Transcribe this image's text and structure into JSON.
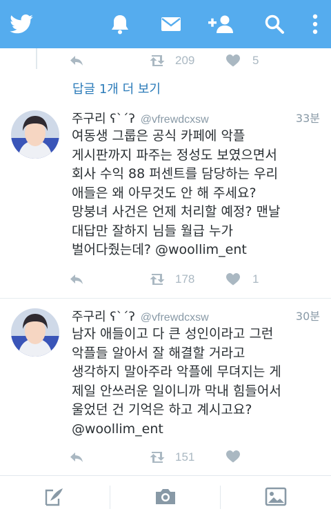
{
  "topbar": {
    "color": "#55acee",
    "icons": [
      "twitter-bird-icon",
      "notifications-bell-icon",
      "messages-envelope-icon",
      "follow-add-user-icon",
      "search-icon",
      "more-vertical-icon"
    ]
  },
  "prev_tweet": {
    "retweets": "209",
    "likes": "5"
  },
  "more_replies_label": "답글 1개 더 보기",
  "tweets": [
    {
      "name": "주구리 ʕ`´ʔ",
      "handle": "@vfrewdcxsw",
      "time": "33분",
      "lines": [
        "여동생 그룹은 공식 카페에 악플",
        "게시판까지 파주는 정성도 보였으면서",
        "회사 수익 88 퍼센트를 담당하는 우리",
        "애들은 왜 아무것도 안 해 주세요?",
        "망붕녀 사건은 언제 처리할 예정? 맨날",
        "대답만 잘하지 님들 월급 누가",
        "벌어다줬는데? @woollim_ent"
      ],
      "retweets": "178",
      "likes": "1"
    },
    {
      "name": "주구리 ʕ`´ʔ",
      "handle": "@vfrewdcxsw",
      "time": "30분",
      "lines": [
        "남자 애들이고 다 큰 성인이라고 그런",
        "악플들 알아서 잘 해결할 거라고",
        "생각하지 말아주라 악플에 무뎌지는 게",
        "제일 안쓰러운 일이니까 막내 힘들어서",
        "울었던 건 기억은 하고 계시고요?",
        "@woollim_ent"
      ],
      "retweets": "151",
      "likes": ""
    }
  ],
  "bottombar": {
    "icons": [
      "compose-tweet-icon",
      "camera-icon",
      "photo-gallery-icon"
    ]
  }
}
